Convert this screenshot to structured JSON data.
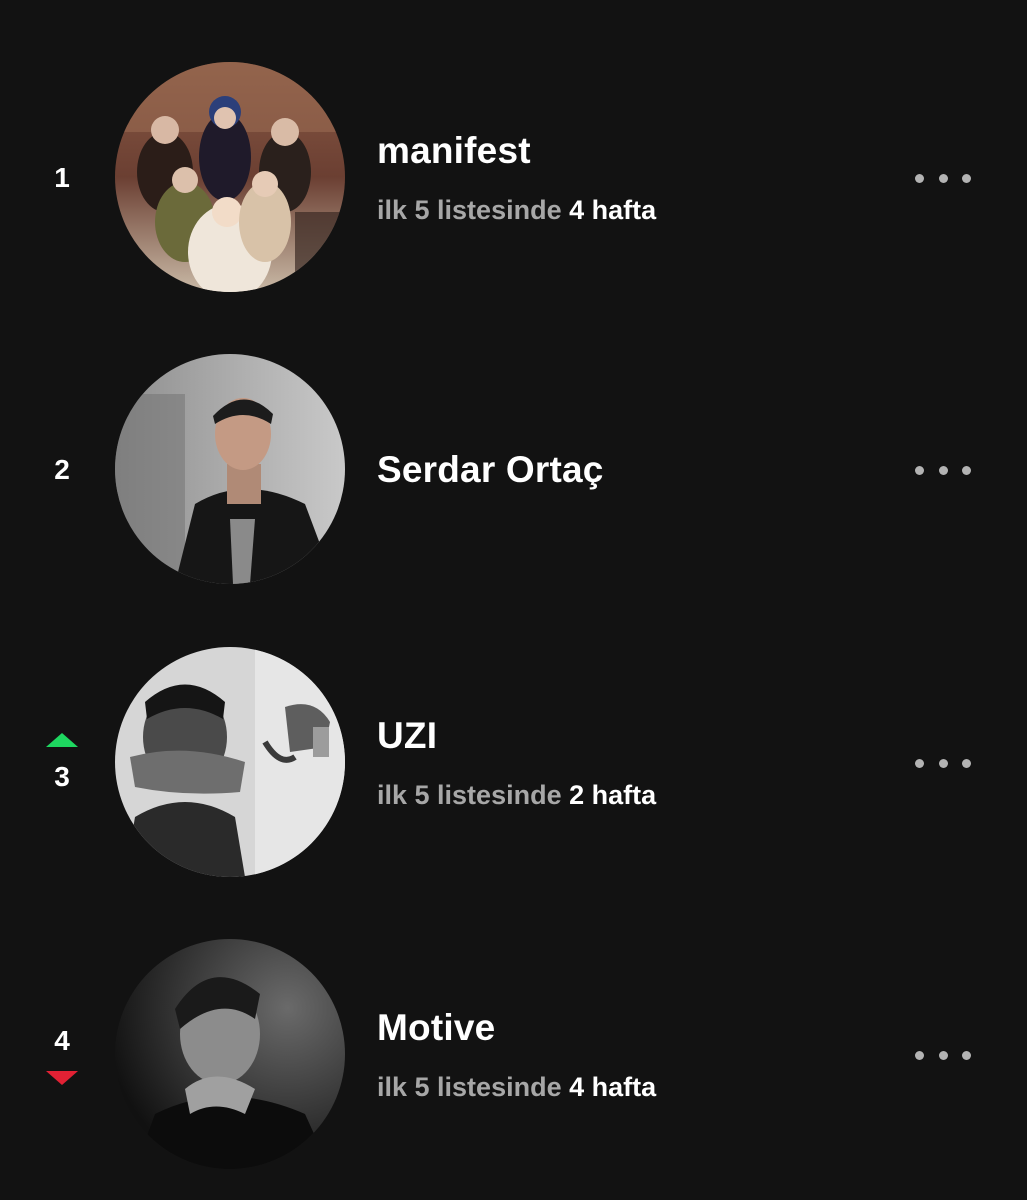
{
  "colors": {
    "background": "#121212",
    "text_primary": "#ffffff",
    "text_secondary": "#a7a7a7",
    "trend_up": "#1ed760",
    "trend_down": "#e22134",
    "more_dots": "#b3b3b3"
  },
  "list": {
    "items": [
      {
        "rank": "1",
        "trend": "none",
        "name": "manifest",
        "stat_prefix": "ilk 5 listesinde",
        "stat_value": "4 hafta",
        "avatar": "group-photo"
      },
      {
        "rank": "2",
        "trend": "none",
        "name": "Serdar Ortaç",
        "stat_prefix": "",
        "stat_value": "",
        "avatar": "portrait-photo"
      },
      {
        "rank": "3",
        "trend": "up",
        "name": "UZI",
        "stat_prefix": "ilk 5 listesinde",
        "stat_value": "2 hafta",
        "avatar": "bw-portrait-photo"
      },
      {
        "rank": "4",
        "trend": "down",
        "name": "Motive",
        "stat_prefix": "ilk 5 listesinde",
        "stat_value": "4 hafta",
        "avatar": "bw-portrait-photo"
      }
    ],
    "more_icon": "more-horizontal-icon"
  }
}
